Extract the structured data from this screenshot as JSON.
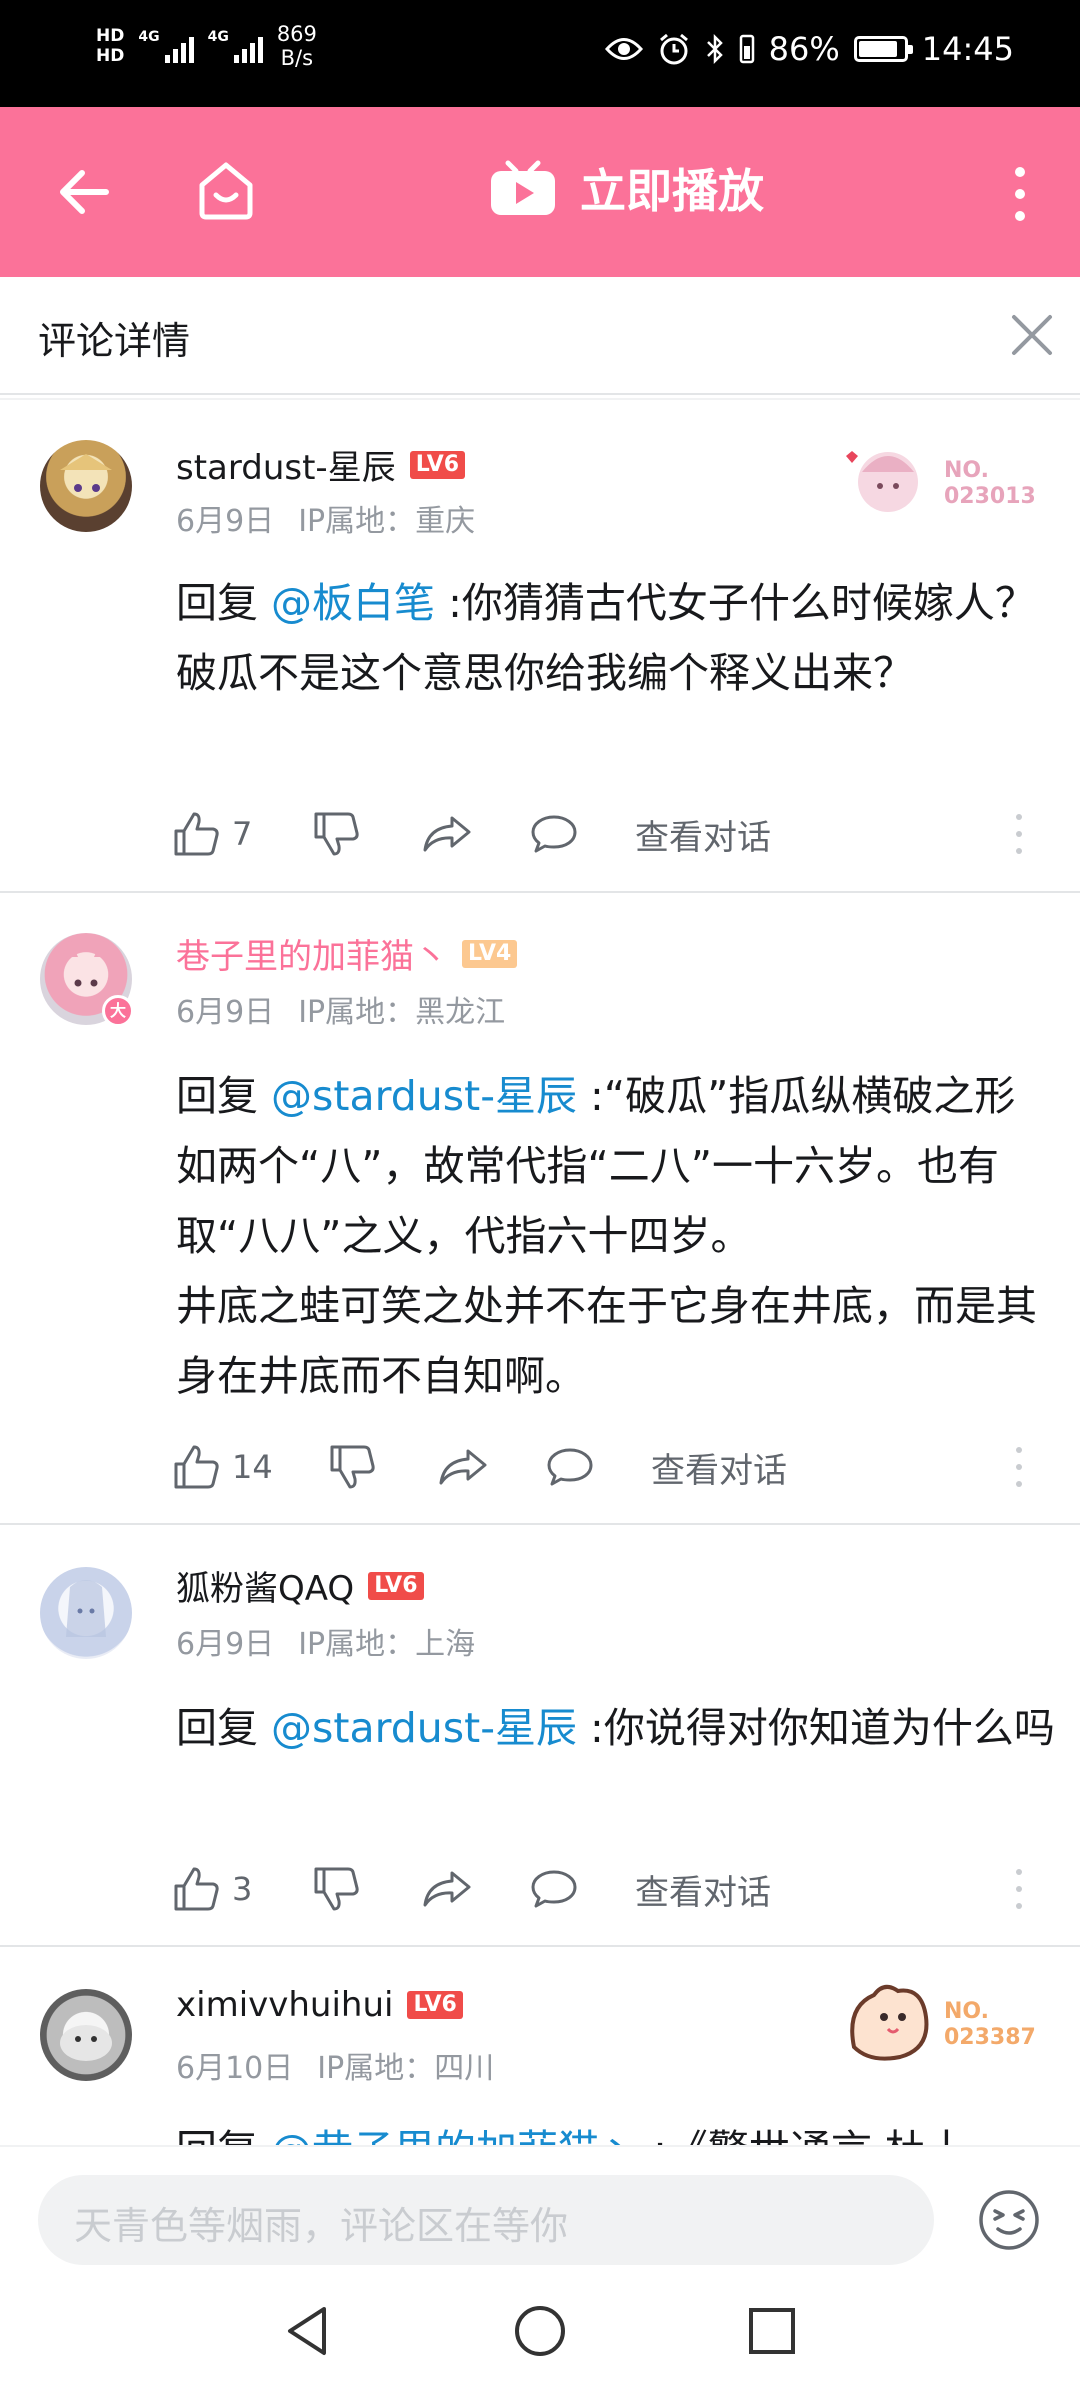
{
  "status_bar": {
    "hd1": "HD",
    "hd2": "HD",
    "net1": "4G",
    "net2": "4G",
    "speed_value": "869",
    "speed_unit": "B/s",
    "battery": "86%",
    "time": "14:45",
    "battery_level": 0.86,
    "icons": [
      "eye-icon",
      "alarm-icon",
      "bluetooth-icon",
      "vibrate-icon",
      "battery-icon"
    ]
  },
  "app_bar": {
    "play_label": "立即播放",
    "icons": [
      "back-arrow-icon",
      "home-icon",
      "tv-play-icon",
      "more-vertical-icon"
    ],
    "background": "#fb7299"
  },
  "sub_header": {
    "title": "评论详情"
  },
  "comments": [
    {
      "username": "stardust-星辰",
      "level": "LV6",
      "date": "6月9日",
      "ip": "IP属地：重庆",
      "reply_prefix": "回复 ",
      "mention": "@板白笔",
      "text": " :你猜猜古代女子什么时候嫁人？破瓜不是这个意思你给我编个释义出来？",
      "likes": "7",
      "conversation": "查看对话",
      "badge_no": "NO.",
      "badge_num": "023013"
    },
    {
      "username": "巷子里的加菲猫丶",
      "level": "LV4",
      "date": "6月9日",
      "ip": "IP属地：黑龙江",
      "reply_prefix": "回复 ",
      "mention": "@stardust-星辰",
      "text": " :“破瓜”指瓜纵横破之形如两个“八”，故常代指“二八”一十六岁。也有取“八八”之义，代指六十四岁。\n井底之蛙可笑之处并不在于它身在井底，而是其身在井底而不自知啊。",
      "likes": "14",
      "conversation": "查看对话",
      "avatar_badge": "大"
    },
    {
      "username": "狐粉酱QAQ",
      "level": "LV6",
      "date": "6月9日",
      "ip": "IP属地：上海",
      "reply_prefix": "回复 ",
      "mention": "@stardust-星辰",
      "text": " :你说得对你知道为什么吗",
      "likes": "3",
      "conversation": "查看对话"
    },
    {
      "username": "ximivvhuihui",
      "level": "LV6",
      "date": "6月10日",
      "ip": "IP属地：四川",
      "reply_prefix": "回复 ",
      "mention": "@巷子里的加菲猫丶",
      "text": " :《警世通言·杜十",
      "badge_no": "NO.",
      "badge_num": "023387"
    }
  ],
  "bottom_bar": {
    "placeholder": "天青色等烟雨，评论区在等你",
    "emoji_icon": "emoji-icon"
  },
  "system_nav": [
    "nav-back-icon",
    "nav-home-icon",
    "nav-recents-icon"
  ]
}
